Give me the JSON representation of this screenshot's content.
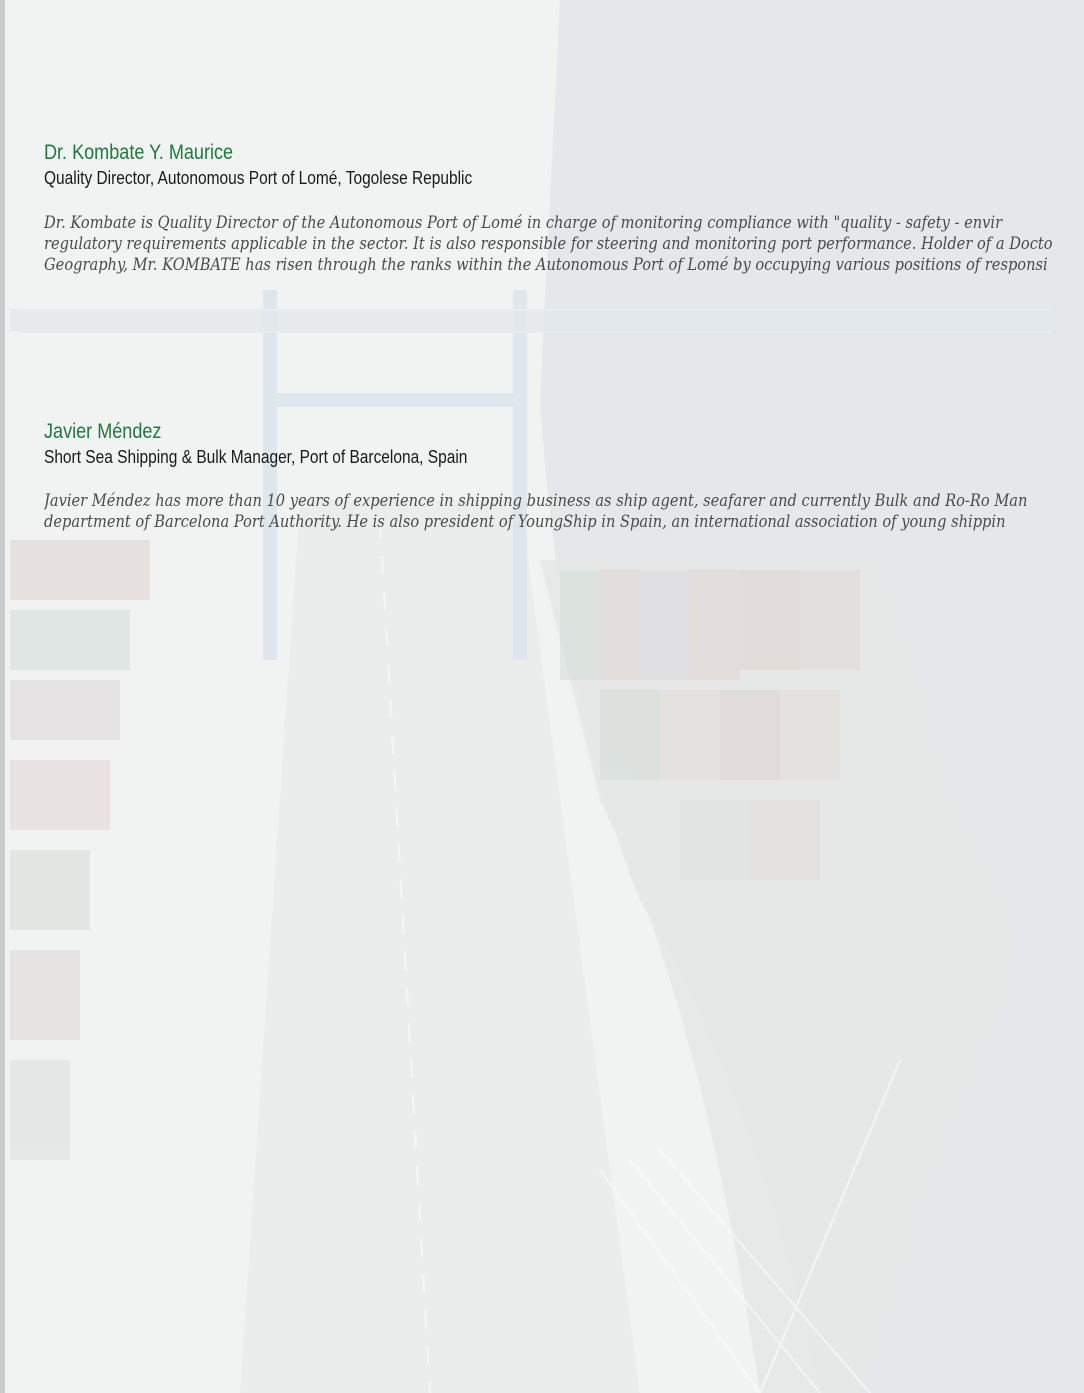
{
  "colors": {
    "name": "#1e7a3c",
    "role": "#1a1a1a",
    "bio": "#4a4a4a",
    "background": "#f2f3f3",
    "water": "#c9d3da"
  },
  "background_image": "aerial-container-port-photo",
  "speakers": [
    {
      "name": "Dr. Kombate Y. Maurice",
      "role": "Quality Director, Autonomous Port of Lomé, Togolese Republic",
      "bio_lines": [
        "Dr. Kombate is Quality Director of the Autonomous Port of Lomé in charge of monitoring compliance with \"quality - safety - envir",
        "regulatory requirements applicable in the sector. It is also responsible for steering and monitoring port performance. Holder of a Docto",
        "Geography, Mr. KOMBATE has risen through the ranks within the Autonomous Port of Lomé by occupying various positions of responsi"
      ]
    },
    {
      "name": "Javier Méndez",
      "role": "Short Sea Shipping & Bulk Manager, Port of Barcelona, Spain",
      "bio_lines": [
        "Javier Méndez has more than 10 years of experience in shipping business as ship agent, seafarer and currently Bulk and Ro-Ro Man",
        "department of Barcelona Port Authority. He is also president of YoungShip in Spain, an international association of young shippin"
      ]
    }
  ]
}
